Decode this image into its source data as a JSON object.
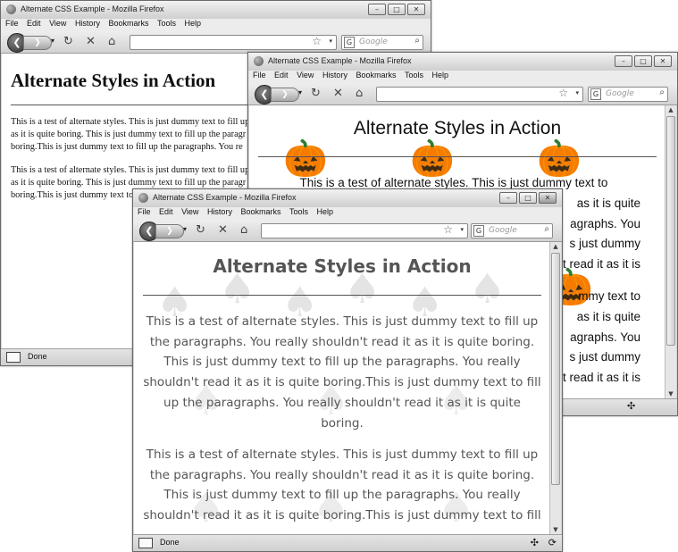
{
  "browser": {
    "title": "Alternate CSS Example - Mozilla Firefox",
    "menu": [
      "File",
      "Edit",
      "View",
      "History",
      "Bookmarks",
      "Tools",
      "Help"
    ],
    "search_placeholder": "Google",
    "status": "Done"
  },
  "page": {
    "heading": "Alternate Styles in Action",
    "paragraph": "This is a test of alternate styles. This is just dummy text to fill up the paragraphs. You really shouldn't read it as it is quite boring. This is just dummy text to fill up the paragraphs. You really shouldn't read it as it is quite boring.This is just dummy text to fill up the paragraphs. You really shouldn't read it as it is quite boring."
  },
  "window_back": {
    "paragraph_1_lines": [
      "This is a test of alternate styles. This is just dummy text to fill up",
      "as it is quite boring. This is just dummy text to fill up the paragr",
      "boring.This is just dummy text to fill up the paragraphs. You re"
    ],
    "paragraph_2_lines": [
      "This is a test of alternate styles. This is just dummy text to fill up",
      "as it is quite boring. This is just dummy text to fill up the paragr",
      "boring.This is just dummy text to fill up the paragraphs. You re"
    ]
  },
  "window_middle": {
    "paragraph_lines": [
      "This is a test of alternate styles. This is just dummy text to",
      "as it is quite",
      "agraphs. You",
      "s just dummy",
      "t read it as it is",
      "mmy text to",
      "as it is quite",
      "agraphs. You",
      "s just dummy",
      "t read it as it is"
    ]
  },
  "icons": {
    "back": "back-arrow-icon",
    "forward": "forward-arrow-icon",
    "reload": "reload-icon",
    "stop": "stop-icon",
    "home": "home-icon",
    "bookmark": "star-icon",
    "search": "magnifier-icon"
  }
}
